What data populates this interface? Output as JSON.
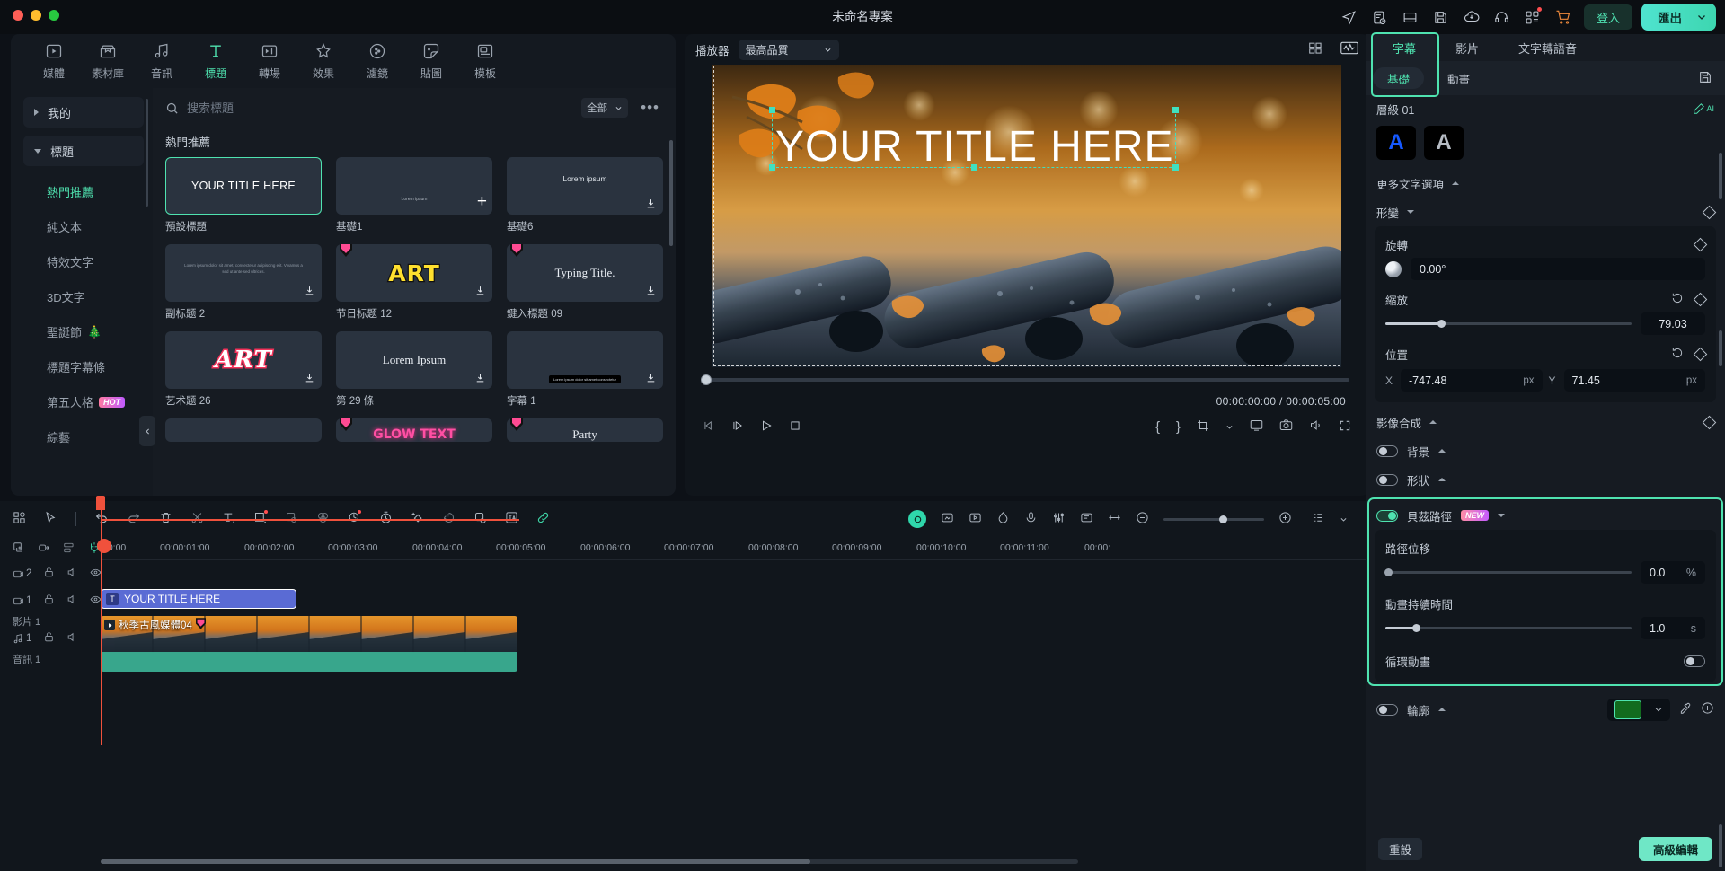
{
  "titlebar": {
    "project_title": "未命名專案",
    "icons": [
      "share-icon",
      "note-clock-icon",
      "layout-icon",
      "save-icon",
      "cloud-upload-icon",
      "headset-icon",
      "apps-grid-icon",
      "cart-icon"
    ],
    "login_label": "登入",
    "export_label": "匯出"
  },
  "left_panel": {
    "categories": [
      {
        "label": "媒體",
        "icon": "media-icon",
        "active": false
      },
      {
        "label": "素材庫",
        "icon": "stock-library-icon",
        "active": false
      },
      {
        "label": "音訊",
        "icon": "audio-icon",
        "active": false
      },
      {
        "label": "標題",
        "icon": "title-icon",
        "active": true
      },
      {
        "label": "轉場",
        "icon": "transition-icon",
        "active": false
      },
      {
        "label": "效果",
        "icon": "effects-icon",
        "active": false
      },
      {
        "label": "濾鏡",
        "icon": "filter-icon",
        "active": false
      },
      {
        "label": "貼圖",
        "icon": "sticker-icon",
        "active": false
      },
      {
        "label": "模板",
        "icon": "template-icon",
        "active": false
      }
    ],
    "nav_groups": [
      {
        "label": "我的",
        "expanded": false
      },
      {
        "label": "標題",
        "expanded": true
      }
    ],
    "nav_items": [
      {
        "label": "熱門推薦",
        "active": true,
        "badge": null,
        "emoji": null
      },
      {
        "label": "純文本",
        "active": false,
        "badge": null,
        "emoji": null
      },
      {
        "label": "特效文字",
        "active": false,
        "badge": null,
        "emoji": null
      },
      {
        "label": "3D文字",
        "active": false,
        "badge": null,
        "emoji": null
      },
      {
        "label": "聖誕節",
        "active": false,
        "badge": null,
        "emoji": "🎄"
      },
      {
        "label": "標題字幕條",
        "active": false,
        "badge": null,
        "emoji": null
      },
      {
        "label": "第五人格",
        "active": false,
        "badge": "HOT",
        "emoji": null
      },
      {
        "label": "綜藝",
        "active": false,
        "badge": null,
        "emoji": null
      }
    ],
    "search": {
      "placeholder": "搜索標題",
      "value": ""
    },
    "filter_label": "全部",
    "more_label": "•••",
    "section_title": "熱門推薦",
    "items": [
      {
        "caption": "預設標題",
        "preview": "YOUR TITLE HERE",
        "style": "white",
        "selected": true,
        "download": false,
        "plus": false,
        "gem": false
      },
      {
        "caption": "基礎1",
        "preview": "Lorem ipsum",
        "style": "small",
        "selected": false,
        "download": false,
        "plus": true,
        "gem": false
      },
      {
        "caption": "基礎6",
        "preview": "Lorem ipsum",
        "style": "small2",
        "selected": false,
        "download": true,
        "plus": false,
        "gem": false
      },
      {
        "caption": "副标题 2",
        "preview": "Lorem ipsum dolor sit amet, consectetur adipiscing elit. Vivamus a sed ut ante sed ultrices.",
        "style": "tiny",
        "selected": false,
        "download": true,
        "plus": false,
        "gem": false
      },
      {
        "caption": "节日标题 12",
        "preview": "ART",
        "style": "art-yellow",
        "selected": false,
        "download": true,
        "plus": false,
        "gem": true
      },
      {
        "caption": "鍵入標題 09",
        "preview": "Typing Title.",
        "style": "serif",
        "selected": false,
        "download": true,
        "plus": false,
        "gem": true
      },
      {
        "caption": "艺术题 26",
        "preview": "ART",
        "style": "art-red",
        "selected": false,
        "download": true,
        "plus": false,
        "gem": false
      },
      {
        "caption": "第 29 條",
        "preview": "Lorem Ipsum",
        "style": "serif",
        "selected": false,
        "download": true,
        "plus": false,
        "gem": false
      },
      {
        "caption": "字幕 1",
        "preview": "Lorem ipsum dolor sit amet consectetur",
        "style": "subtitle-bar",
        "selected": false,
        "download": true,
        "plus": false,
        "gem": false
      },
      {
        "caption": "",
        "preview": "",
        "style": "blank",
        "selected": false,
        "download": false,
        "plus": false,
        "gem": false
      },
      {
        "caption": "",
        "preview": "GLOW TEXT",
        "style": "glow",
        "selected": false,
        "download": false,
        "plus": false,
        "gem": true
      },
      {
        "caption": "",
        "preview": "Party",
        "style": "serif",
        "selected": false,
        "download": false,
        "plus": false,
        "gem": true
      }
    ]
  },
  "preview": {
    "label": "播放器",
    "quality": "最高品質",
    "right_icons": [
      "grid-layout-icon",
      "waveform-icon"
    ],
    "title_overlay": "YOUR TITLE HERE",
    "current_time": "00:00:00:00",
    "separator": "/",
    "total_time": "00:00:05:00",
    "controls": [
      "prev-frame-icon",
      "step-forward-icon",
      "play-icon",
      "stop-icon"
    ],
    "right_controls": [
      "mark-in-icon",
      "mark-out-icon",
      "crop-icon",
      "chevron-down-icon",
      "snapshot-screen-icon",
      "camera-icon",
      "volume-icon",
      "fullscreen-icon"
    ],
    "brace_left": "{",
    "brace_right": "}"
  },
  "timeline": {
    "tools": [
      "grid-view-icon",
      "cursor-select-icon",
      "undo-icon",
      "redo-icon",
      "delete-icon",
      "split-scissors-icon",
      "text-icon",
      "crop-square-icon",
      "mask-icon",
      "color-icon",
      "auto-ai-icon",
      "speed-icon",
      "keyframe-icon",
      "motion-track-icon",
      "audio-detach-icon",
      "translate-icon",
      "link-icon"
    ],
    "right_tools": [
      "record-icon",
      "green-screen-icon",
      "picture-in-picture-icon",
      "mask-shape-icon",
      "mic-icon",
      "mixer-icon",
      "marker-icon",
      "resize-icon"
    ],
    "zoom_out": "−",
    "zoom_in": "+",
    "track_tools": [
      "add-track-icon",
      "export-track-icon",
      "track-manage-icon",
      "magnet-icon"
    ],
    "ruler_ticks": [
      "00:00",
      "00:00:01:00",
      "00:00:02:00",
      "00:00:03:00",
      "00:00:04:00",
      "00:00:05:00",
      "00:00:06:00",
      "00:00:07:00",
      "00:00:08:00",
      "00:00:09:00",
      "00:00:10:00",
      "00:00:11:00",
      "00:00:"
    ],
    "tracks": [
      {
        "index": "2",
        "type": "video",
        "name": "",
        "clip": "YOUR TITLE HERE"
      },
      {
        "index": "1",
        "type": "video",
        "name": "影片 1",
        "clip": "秋季古風媒體04"
      },
      {
        "index": "1",
        "type": "audio",
        "name": "音訊 1",
        "clip": ""
      }
    ]
  },
  "right_panel": {
    "tabs": [
      {
        "label": "字幕",
        "active": true
      },
      {
        "label": "影片",
        "active": false
      },
      {
        "label": "文字轉語音",
        "active": false
      }
    ],
    "subtabs": [
      {
        "label": "基礎",
        "active": true
      },
      {
        "label": "動畫",
        "active": false
      }
    ],
    "save_icon": "save-icon",
    "layer_label": "層級 01",
    "ai_label": "AI",
    "presets": [
      {
        "glyph": "A",
        "color": "#1659ff"
      },
      {
        "glyph": "A",
        "color": "#b6bcc4"
      }
    ],
    "more_text_options": "更多文字選項",
    "transform": {
      "title": "形變",
      "rotation_label": "旋轉",
      "rotation_value": "0.00°",
      "scale_label": "縮放",
      "scale_value": "79.03",
      "scale_pct": 22,
      "position_label": "位置",
      "x_label": "X",
      "x_value": "-747.48",
      "x_unit": "px",
      "y_label": "Y",
      "y_value": "71.45",
      "y_unit": "px"
    },
    "compositing": {
      "title": "影像合成",
      "background_label": "背景",
      "shape_label": "形狀"
    },
    "bezier": {
      "title": "貝茲路徑",
      "badge": "NEW",
      "enabled": true,
      "offset_label": "路徑位移",
      "offset_value": "0.0",
      "offset_unit": "%",
      "offset_pct": 0,
      "duration_label": "動畫持續時間",
      "duration_value": "1.0",
      "duration_unit": "s",
      "duration_pct": 12,
      "loop_label": "循環動畫",
      "loop_enabled": false
    },
    "outline": {
      "label": "輪廓",
      "enabled": false,
      "color": "#126b1e",
      "tools": [
        "eyedropper-icon",
        "add-color-icon"
      ]
    },
    "footer": {
      "reset_label": "重設",
      "advanced_label": "高級編輯"
    }
  },
  "colors": {
    "accent": "#4fe3b0",
    "panel": "#161b22",
    "bg": "#0d1117",
    "playhead": "#f0513c",
    "title_clip": "#5a6bd4",
    "audio_clip": "#38a68c"
  }
}
